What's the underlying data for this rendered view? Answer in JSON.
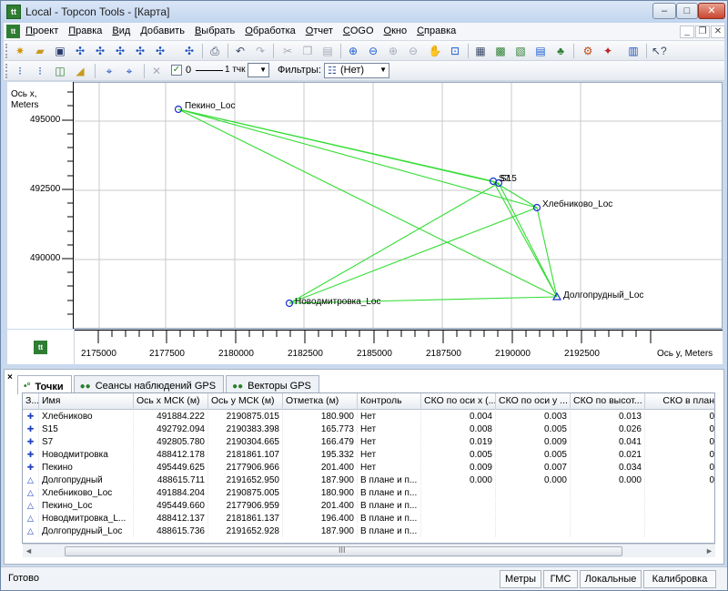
{
  "window": {
    "title": "Local - Topcon Tools - [Карта]",
    "controls": {
      "minimize": "–",
      "maximize": "□",
      "close": "✕"
    },
    "mdi_controls": [
      "_",
      "❐",
      "✕"
    ]
  },
  "menu": [
    "Проект",
    "Правка",
    "Вид",
    "Добавить",
    "Выбрать",
    "Обработка",
    "Отчет",
    "COGO",
    "Окно",
    "Справка"
  ],
  "toolbar2": {
    "line_value": "0",
    "line_width": "1 тчк",
    "filters_label": "Фильтры:",
    "filter_value": "(Нет)"
  },
  "map": {
    "y_axis_label": [
      "Ось x,",
      "Meters"
    ],
    "x_axis_label": "Ось y, Meters",
    "y_ticks": [
      "495000",
      "492500",
      "490000"
    ],
    "x_ticks": [
      "2175000",
      "2177500",
      "2180000",
      "2182500",
      "2185000",
      "2187500",
      "2190000",
      "2192500"
    ],
    "point_labels": {
      "pekino": "Пекино_Loc",
      "s7": "S7",
      "s15": "S15",
      "khlebnikovo": "Хлебниково_Loc",
      "dolgoprudny": "Долгопрудный_Loc",
      "novodmitrovka": "Новодмитровка_Loc"
    },
    "colors": {
      "vector": "#33dd33",
      "point": "#1a2fd0",
      "grid": "#c8c8c8"
    }
  },
  "tabs": [
    {
      "label": "Точки",
      "icon": "points-icon",
      "active": true
    },
    {
      "label": "Сеансы наблюдений GPS",
      "icon": "gps-sessions-icon",
      "active": false
    },
    {
      "label": "Векторы GPS",
      "icon": "gps-vectors-icon",
      "active": false
    }
  ],
  "grid": {
    "headers": [
      "З...",
      "Имя",
      "Ось x МСК (м)",
      "Ось y МСК (м)",
      "Отметка (м)",
      "Контроль",
      "СКО по оси x (...",
      "СКО по оси y ...",
      "СКО по высот...",
      "СКО в план"
    ],
    "rows": [
      {
        "icon": "✚",
        "name": "Хлебниково",
        "x": "491884.222",
        "y": "2190875.015",
        "h": "180.900",
        "control": "Нет",
        "sx": "0.004",
        "sy": "0.003",
        "sh": "0.013",
        "sp": "0"
      },
      {
        "icon": "✚",
        "name": "S15",
        "x": "492792.094",
        "y": "2190383.398",
        "h": "165.773",
        "control": "Нет",
        "sx": "0.008",
        "sy": "0.005",
        "sh": "0.026",
        "sp": "0"
      },
      {
        "icon": "✚",
        "name": "S7",
        "x": "492805.780",
        "y": "2190304.665",
        "h": "166.479",
        "control": "Нет",
        "sx": "0.019",
        "sy": "0.009",
        "sh": "0.041",
        "sp": "0"
      },
      {
        "icon": "✚",
        "name": "Новодмитровка",
        "x": "488412.178",
        "y": "2181861.107",
        "h": "195.332",
        "control": "Нет",
        "sx": "0.005",
        "sy": "0.005",
        "sh": "0.021",
        "sp": "0"
      },
      {
        "icon": "✚",
        "name": "Пекино",
        "x": "495449.625",
        "y": "2177906.966",
        "h": "201.400",
        "control": "Нет",
        "sx": "0.009",
        "sy": "0.007",
        "sh": "0.034",
        "sp": "0"
      },
      {
        "icon": "△",
        "name": "Долгопрудный",
        "x": "488615.711",
        "y": "2191652.950",
        "h": "187.900",
        "control": "В плане и п...",
        "sx": "0.000",
        "sy": "0.000",
        "sh": "0.000",
        "sp": "0"
      },
      {
        "icon": "△",
        "name": "Хлебниково_Loc",
        "x": "491884.204",
        "y": "2190875.005",
        "h": "180.900",
        "control": "В плане и п...",
        "sx": "",
        "sy": "",
        "sh": "",
        "sp": ""
      },
      {
        "icon": "△",
        "name": "Пекино_Loc",
        "x": "495449.660",
        "y": "2177906.959",
        "h": "201.400",
        "control": "В плане и п...",
        "sx": "",
        "sy": "",
        "sh": "",
        "sp": ""
      },
      {
        "icon": "△",
        "name": "Новодмитровка_L...",
        "x": "488412.137",
        "y": "2181861.137",
        "h": "196.400",
        "control": "В плане и п...",
        "sx": "",
        "sy": "",
        "sh": "",
        "sp": ""
      },
      {
        "icon": "△",
        "name": "Долгопрудный_Loc",
        "x": "488615.736",
        "y": "2191652.928",
        "h": "187.900",
        "control": "В плане и п...",
        "sx": "",
        "sy": "",
        "sh": "",
        "sp": ""
      }
    ]
  },
  "scrollbar": {
    "left": "◄",
    "grip": "III",
    "right": "►"
  },
  "status": {
    "text": "Готово",
    "buttons": [
      "Метры",
      "ГМС",
      "Локальные",
      "Калибровка"
    ]
  }
}
